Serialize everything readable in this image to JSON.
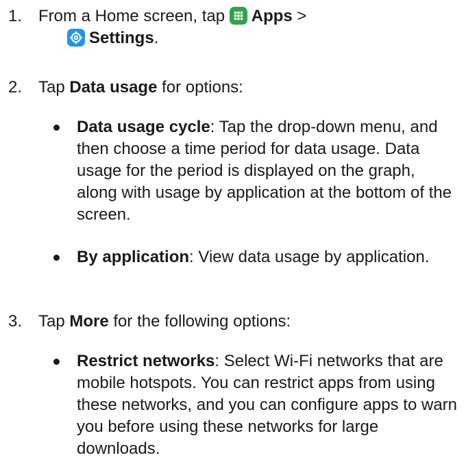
{
  "steps": [
    {
      "number": "1.",
      "text_a": "From a Home screen, tap ",
      "apps_label": "Apps",
      "separator": " >",
      "settings_label": "Settings",
      "period": "."
    },
    {
      "number": "2.",
      "text_a": "Tap ",
      "bold": "Data usage",
      "text_b": " for options:",
      "bullets": [
        {
          "title": "Data usage cycle",
          "text": ": Tap the drop-down menu, and then choose a time period for data usage. Data usage for the period is displayed on the graph, along with usage by application at the bottom of the screen."
        },
        {
          "title": "By application",
          "text": ": View data usage by application."
        }
      ]
    },
    {
      "number": "3.",
      "text_a": "Tap ",
      "bold": "More",
      "text_b": " for the following options:",
      "bullets": [
        {
          "title": "Restrict networks",
          "text": ": Select Wi-Fi networks that are mobile hotspots. You can restrict apps from using these networks, and you can configure apps to warn you before using these networks for large downloads."
        }
      ]
    }
  ],
  "icons": {
    "apps": "apps-grid-icon",
    "settings": "settings-gear-icon",
    "apps_color": "#2fa34a",
    "settings_color": "#2196e8"
  }
}
